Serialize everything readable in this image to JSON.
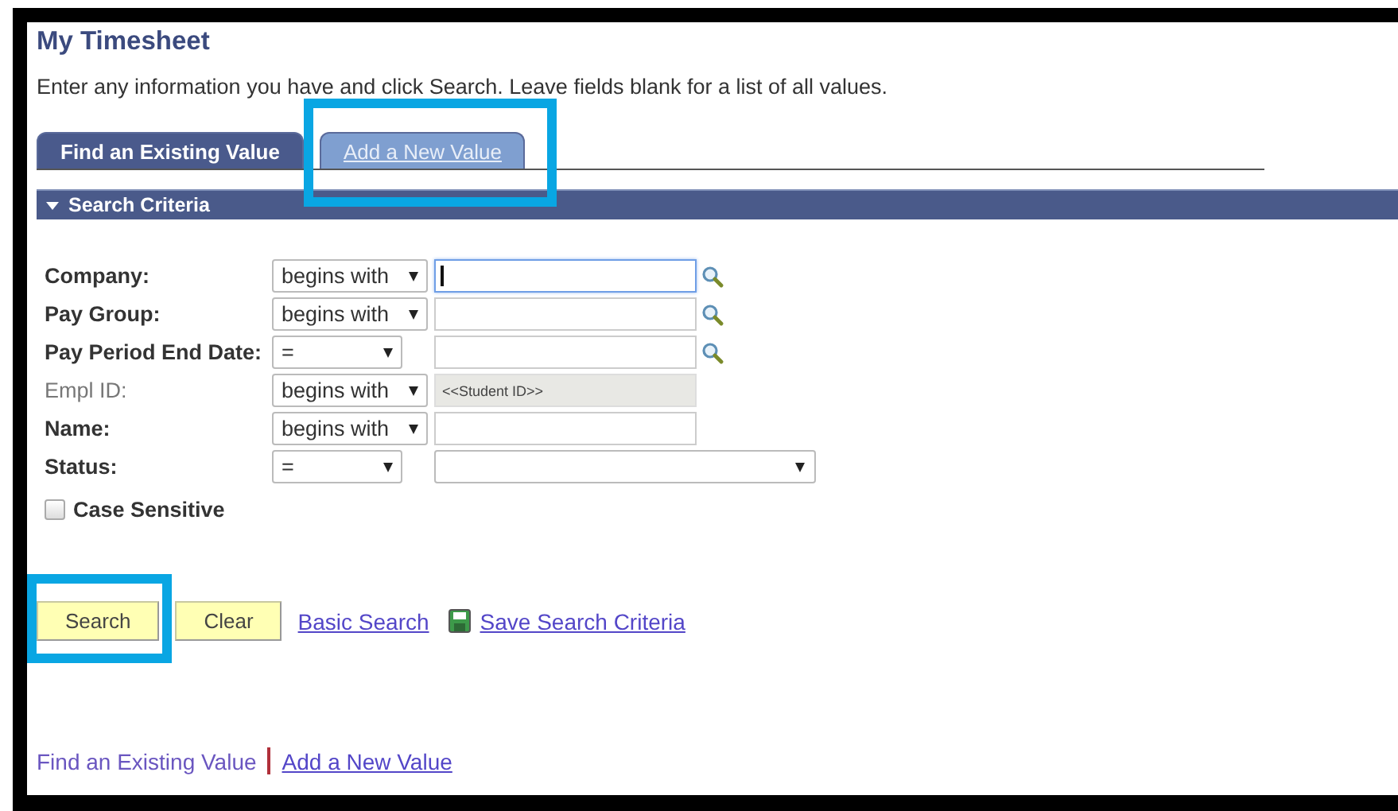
{
  "page": {
    "title": "My Timesheet",
    "instructions": "Enter any information you have and click Search. Leave fields blank for a list of all values."
  },
  "tabs": [
    {
      "label": "Find an Existing Value",
      "selected": true,
      "highlighted": false
    },
    {
      "label": "Add a New Value",
      "selected": false,
      "highlighted": true
    }
  ],
  "section": {
    "title": "Search Criteria",
    "expanded": true
  },
  "fields": [
    {
      "label": "Company:",
      "operator": "begins with",
      "kind": "lookup",
      "disabled": false,
      "focused": true
    },
    {
      "label": "Pay Group:",
      "operator": "begins with",
      "kind": "lookup",
      "disabled": false,
      "focused": false
    },
    {
      "label": "Pay Period End Date:",
      "operator": "=",
      "kind": "lookup",
      "disabled": false,
      "focused": false
    },
    {
      "label": "Empl ID:",
      "operator": "begins with",
      "kind": "text",
      "disabled": true,
      "focused": false,
      "value": "<<Student ID>>"
    },
    {
      "label": "Name:",
      "operator": "begins with",
      "kind": "text",
      "disabled": false,
      "focused": false
    },
    {
      "label": "Status:",
      "operator": "=",
      "kind": "dropdown",
      "disabled": false,
      "focused": false
    }
  ],
  "case_sensitive": {
    "label": "Case Sensitive",
    "checked": false
  },
  "buttons": [
    {
      "label": "Search",
      "highlighted": true
    },
    {
      "label": "Clear",
      "highlighted": false
    }
  ],
  "links": [
    {
      "label": "Basic Search",
      "kind": "link"
    },
    {
      "label": "Save Search Criteria",
      "kind": "save"
    }
  ],
  "footer_links": [
    {
      "label": "Find an Existing Value",
      "current": true
    },
    {
      "label": "Add a New Value",
      "current": false
    }
  ]
}
